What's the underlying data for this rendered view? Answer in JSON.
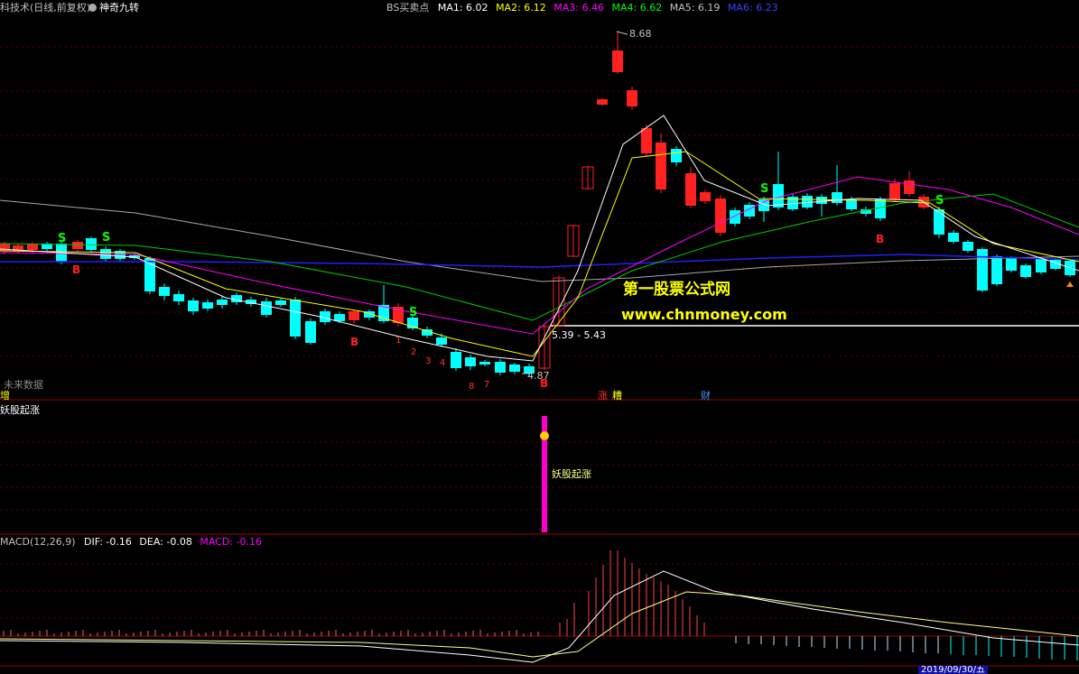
{
  "header": {
    "app_title": "科技术(日线,前复权)",
    "indicator_name": "神奇九转",
    "bs_title": "BS买卖点",
    "ma": [
      {
        "label": "MA1: 6.02",
        "color": "#ffffff"
      },
      {
        "label": "MA2: 6.12",
        "color": "#ffff00"
      },
      {
        "label": "MA3: 6.46",
        "color": "#ff00ff"
      },
      {
        "label": "MA4: 6.62",
        "color": "#00ff00"
      },
      {
        "label": "MA5: 6.19",
        "color": "#c0c0c0"
      },
      {
        "label": "MA6: 6.23",
        "color": "#2222ff"
      }
    ]
  },
  "price_panel": {
    "peak_label": "8.68",
    "low_label": "4.87",
    "range_label": "5.39 - 5.43",
    "future_data_label": "未来数据",
    "watermark_cn": "第一股票公式网",
    "watermark_url": "www.chnmoney.com",
    "bottom_left_mark": "增",
    "event_marks": [
      {
        "text": "涨",
        "color": "#ff3030"
      },
      {
        "text": "糟",
        "color": "#ffff00"
      },
      {
        "text": "财",
        "color": "#3399ff"
      }
    ],
    "signals": [
      {
        "text": "S",
        "color": "#00ff00"
      },
      {
        "text": "S",
        "color": "#00ff00"
      },
      {
        "text": "B",
        "color": "#ff2020"
      },
      {
        "text": "S",
        "color": "#00ff00"
      },
      {
        "text": "B",
        "color": "#ff2020"
      },
      {
        "text": "B",
        "color": "#ff2020"
      },
      {
        "text": "S",
        "color": "#00ff00"
      },
      {
        "text": "S",
        "color": "#00ff00"
      },
      {
        "text": "B",
        "color": "#ff2020"
      }
    ],
    "countdown": [
      "1",
      "2",
      "3",
      "4",
      "8",
      "7"
    ]
  },
  "demon_panel": {
    "title": "妖股起涨",
    "signal_label": "妖股起涨",
    "title_color": "#ffffff",
    "bar_color": "#ff00cc"
  },
  "macd_panel": {
    "title": "MACD(12,26,9)",
    "dif": "DIF: -0.16",
    "dea": "DEA: -0.08",
    "macd": "MACD: -0.16",
    "dif_color": "#ffffff",
    "dea_color": "#ffffff",
    "macd_color": "#ff00ff"
  },
  "footer": {
    "date_highlight": "2019/09/30/五"
  }
}
